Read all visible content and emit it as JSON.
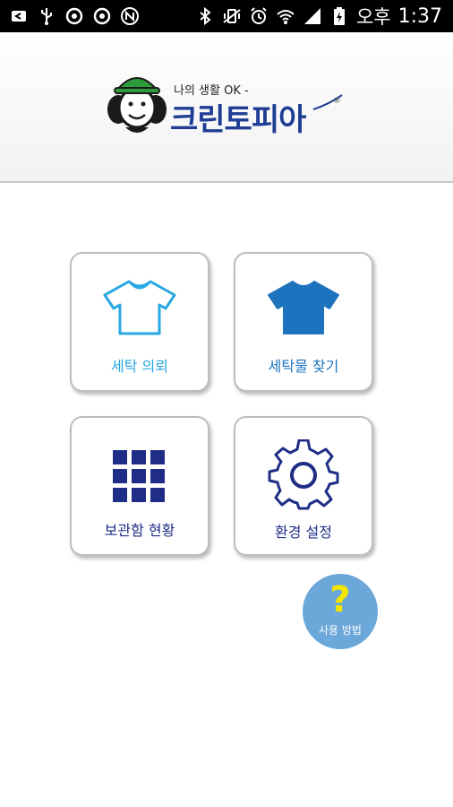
{
  "status_bar": {
    "left_icons": [
      "usb-debug-icon",
      "usb-icon",
      "sync-icon",
      "sync-icon",
      "nfc-icon"
    ],
    "right_icons": [
      "bluetooth-icon",
      "vibrate-icon",
      "alarm-icon",
      "wifi-icon",
      "signal-icon",
      "battery-icon"
    ],
    "ampm": "오후",
    "time": "1:37"
  },
  "header": {
    "tagline": "나의 생활 OK -",
    "brand": "크린토피아",
    "registered_mark": "®"
  },
  "menu": {
    "request_label": "세탁 의뢰",
    "find_label": "세탁물 찾기",
    "storage_label": "보관함 현황",
    "settings_label": "환경 설정"
  },
  "help": {
    "symbol": "?",
    "label": "사용 방법"
  },
  "colors": {
    "light_blue": "#29a8e0",
    "mid_blue": "#1e73be",
    "navy": "#1f2d86",
    "help_bg": "#6ba7d8",
    "help_symbol": "#f5e600"
  }
}
